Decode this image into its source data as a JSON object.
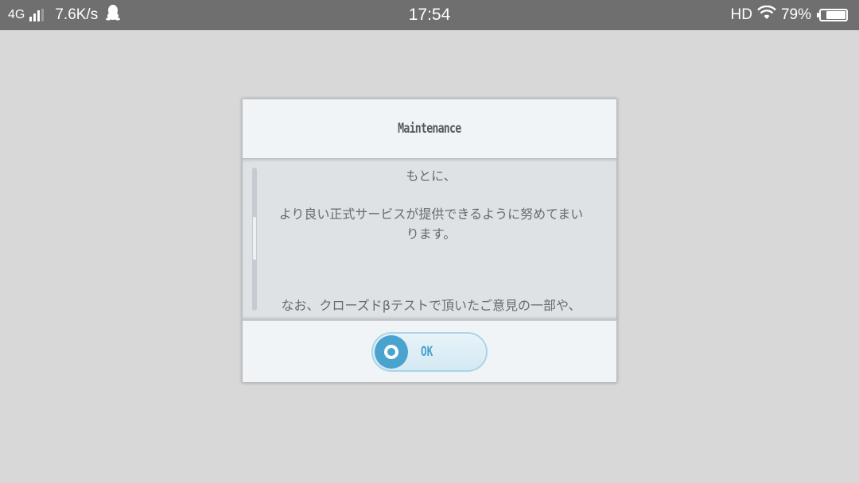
{
  "status_bar": {
    "network": "4G",
    "speed": "7.6K/s",
    "time": "17:54",
    "hd": "HD",
    "battery": "79%",
    "battery_level": 0.79,
    "icons": [
      "signal-icon",
      "qq-penguin-icon",
      "wifi-icon",
      "battery-icon"
    ]
  },
  "dialog": {
    "title": "Maintenance",
    "lines": [
      "もとに、",
      "より良い正式サービスが提供できるように努めてまい",
      "ります。",
      "なお、クローズドβテストで頂いたご意見の一部や、"
    ],
    "ok_label": "OK"
  },
  "colors": {
    "status_bar": "#6f6f6f",
    "background": "#d8d8d8",
    "accent": "#4aa2cf"
  }
}
